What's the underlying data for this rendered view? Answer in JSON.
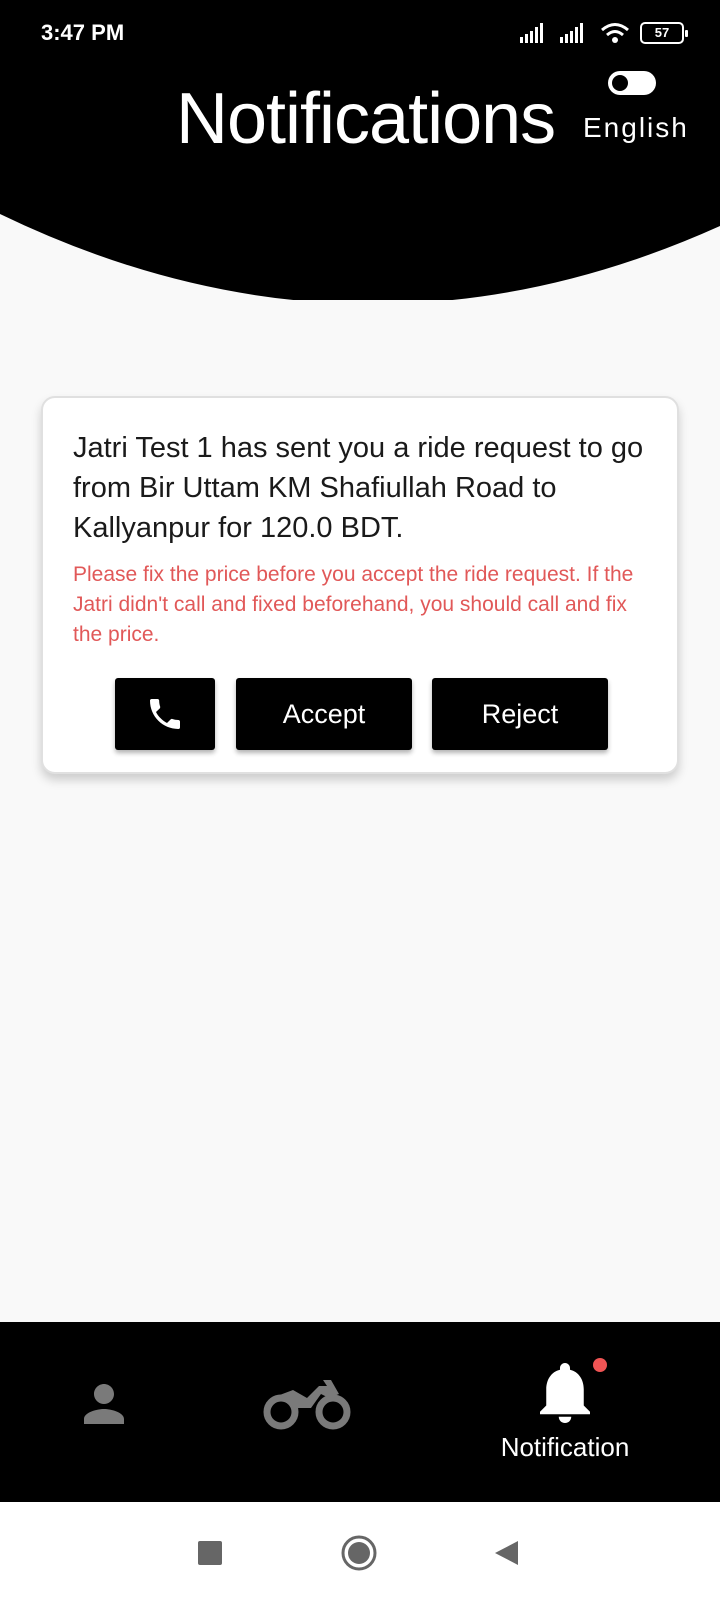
{
  "status_bar": {
    "time": "3:47 PM",
    "battery": "57",
    "icons": [
      "signal-icon",
      "signal-icon",
      "wifi-icon",
      "battery-icon"
    ]
  },
  "header": {
    "title": "Notifications",
    "language_label": "English",
    "language_toggle_on": false
  },
  "notification": {
    "message": "Jatri Test 1 has sent you a ride request to go from Bir Uttam KM Shafiullah Road to Kallyanpur for 120.0 BDT.",
    "warning": "Please fix the price before you accept the ride request. If the Jatri didn't call and fixed beforehand, you should call and fix the price.",
    "call_icon": "phone-icon",
    "accept_label": "Accept",
    "reject_label": "Reject"
  },
  "bottom_nav": {
    "items": [
      {
        "icon": "person-icon",
        "label": "",
        "active": false
      },
      {
        "icon": "motorcycle-icon",
        "label": "",
        "active": false
      },
      {
        "icon": "bell-icon",
        "label": "Notification",
        "active": true,
        "has_badge": true
      }
    ]
  },
  "colors": {
    "header_bg": "#000000",
    "page_bg": "#f9f9f9",
    "warning_text": "#e15858",
    "inactive_icon": "#7a7a7a",
    "badge": "#f05454"
  },
  "system_nav": {
    "icons": [
      "recents-icon",
      "home-icon",
      "back-icon"
    ]
  }
}
